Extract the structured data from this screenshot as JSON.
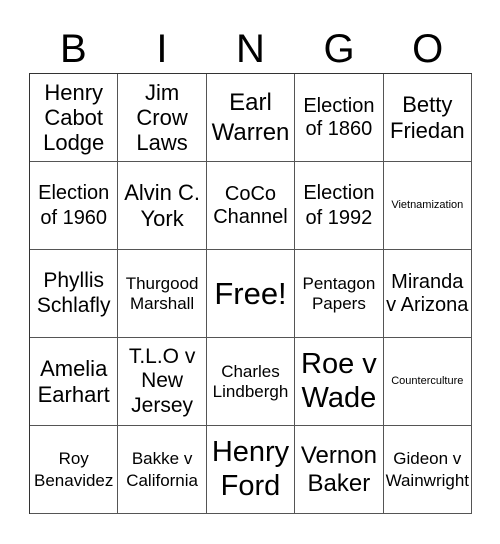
{
  "header": {
    "letters": [
      "B",
      "I",
      "N",
      "G",
      "O"
    ]
  },
  "cells": [
    "Henry Cabot Lodge",
    "Jim Crow Laws",
    "Earl Warren",
    "Election of 1860",
    "Betty Friedan",
    "Election of 1960",
    "Alvin C. York",
    "CoCo Channel",
    "Election of 1992",
    "Vietnamization",
    "Phyllis Schlafly",
    "Thurgood Marshall",
    "Free!",
    "Pentagon Papers",
    "Miranda v Arizona",
    "Amelia Earhart",
    "T.L.O v New Jersey",
    "Charles Lindbergh",
    "Roe v Wade",
    "Counterculture",
    "Roy Benavidez",
    "Bakke v California",
    "Henry Ford",
    "Vernon Baker",
    "Gideon v Wainwright"
  ]
}
